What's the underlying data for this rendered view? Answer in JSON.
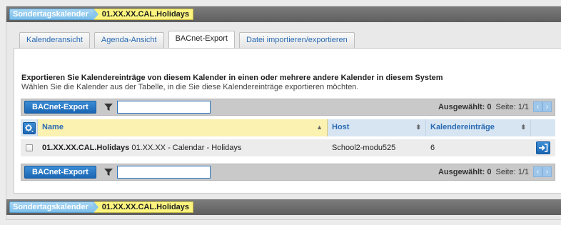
{
  "breadcrumb": {
    "root": "Sondertagskalender",
    "current": "01.XX.XX.CAL.Holidays"
  },
  "tabs": [
    {
      "label": "Kalenderansicht"
    },
    {
      "label": "Agenda-Ansicht"
    },
    {
      "label": "BACnet-Export"
    },
    {
      "label": "Datei importieren/exportieren"
    }
  ],
  "active_tab": "BACnet-Export",
  "panel": {
    "heading": "Exportieren Sie Kalendereinträge von diesem Kalender in einen oder mehrere andere Kalender in diesem System",
    "subheading": "Wählen Sie die Kalender aus der Tabelle, in die Sie diese Kalendereinträge exportieren möchten."
  },
  "toolbar": {
    "export_label": "BACnet-Export",
    "filter_value": "",
    "selected": "Ausgewählt: 0",
    "page": "Seite: 1/1",
    "prev": "‹",
    "next": "›"
  },
  "table": {
    "columns": [
      {
        "label": "Name",
        "sort": "▲"
      },
      {
        "label": "Host",
        "sort": "⬍"
      },
      {
        "label": "Kalendereinträge",
        "sort": "⬍"
      }
    ],
    "rows": [
      {
        "name_bold": "01.XX.XX.CAL.Holidays",
        "name_rest": " 01.XX.XX - Calendar - Holidays",
        "host": "School2-modu525",
        "entries": "6"
      }
    ]
  },
  "colors": {
    "accent_blue": "#1a66b3",
    "breadcrumb_blue": "#88c6ee",
    "breadcrumb_yellow": "#fbf47e",
    "header_yellow": "#fbf1b0",
    "header_blue": "#d7e5f3"
  },
  "icons": {
    "settings": "gear-dropdown-icon",
    "filter": "filter-icon",
    "export_action": "export-arrow-icon"
  }
}
